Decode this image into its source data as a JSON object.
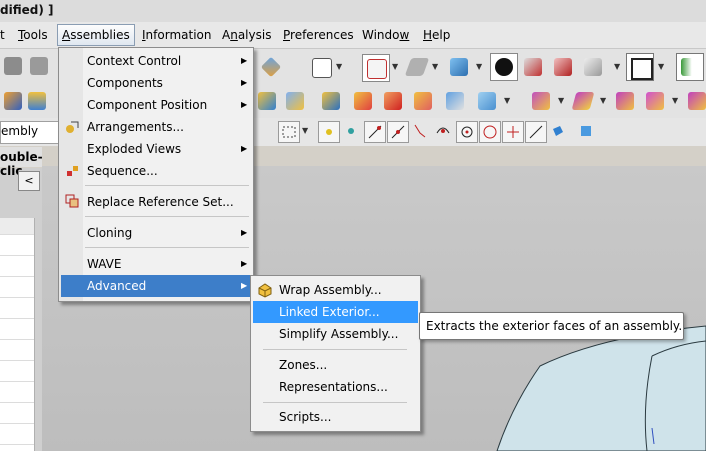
{
  "window": {
    "title_fragment": "dified) ]"
  },
  "menubar": {
    "items": [
      {
        "label": "t",
        "key": "tools-fragment"
      },
      {
        "label": "Tools"
      },
      {
        "label": "Assemblies"
      },
      {
        "label": "Information"
      },
      {
        "label": "Analysis"
      },
      {
        "label": "Preferences"
      },
      {
        "label": "Window"
      },
      {
        "label": "Help"
      }
    ]
  },
  "left_panel": {
    "selection_filter_value": "embly",
    "navigator_header": "ouble-clic",
    "back_button": "<"
  },
  "assemblies_menu": {
    "items": [
      {
        "label": "Context Control",
        "submenu": true
      },
      {
        "label": "Components",
        "submenu": true
      },
      {
        "label": "Component Position",
        "submenu": true
      },
      {
        "label": "Arrangements...",
        "submenu": false,
        "icon": "arrangements-icon"
      },
      {
        "label": "Exploded Views",
        "submenu": true
      },
      {
        "label": "Sequence...",
        "submenu": false,
        "icon": "sequence-icon"
      },
      {
        "label": "Replace Reference Set...",
        "submenu": false,
        "icon": "replace-reference-set-icon"
      },
      {
        "label": "Cloning",
        "submenu": true
      },
      {
        "label": "WAVE",
        "submenu": true
      },
      {
        "label": "Advanced",
        "submenu": true,
        "highlighted": true
      }
    ]
  },
  "advanced_menu": {
    "items": [
      {
        "label": "Wrap Assembly...",
        "icon": "wrap-assembly-icon"
      },
      {
        "label": "Linked Exterior...",
        "highlighted": true
      },
      {
        "label": "Simplify Assembly..."
      },
      {
        "label": "Zones..."
      },
      {
        "label": "Representations..."
      },
      {
        "label": "Scripts..."
      }
    ]
  },
  "tooltip": {
    "text": "Extracts the exterior faces of an assembly."
  },
  "colors": {
    "menu_highlight": "#3d7ec9",
    "submenu_highlight": "#3399ff",
    "menu_background": "#f1f1f1",
    "graphics_background": "#c4c4c4",
    "model_surface": "#cfe3ea"
  }
}
